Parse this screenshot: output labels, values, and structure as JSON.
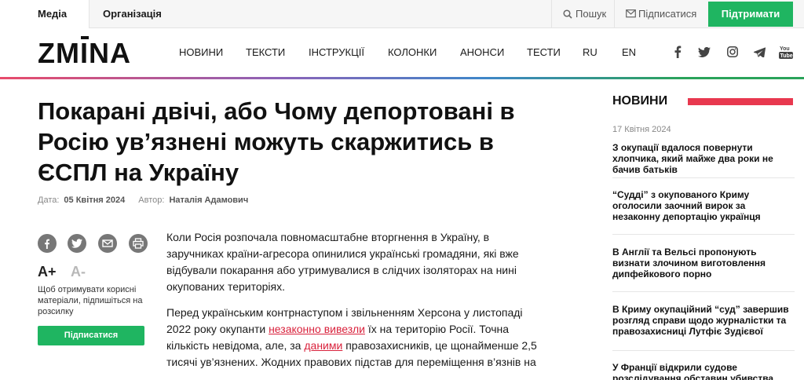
{
  "topbar": {
    "tab_media": "Медіа",
    "tab_org": "Організація",
    "search": "Пошук",
    "subscribe": "Підписатися",
    "support": "Підтримати"
  },
  "header": {
    "logo": "ZMINA",
    "nav": [
      "НОВИНИ",
      "ТЕКСТИ",
      "ІНСТРУКЦІЇ",
      "КОЛОНКИ",
      "АНОНСИ",
      "ТЕСТИ",
      "RU",
      "EN"
    ],
    "social": [
      "facebook-icon",
      "twitter-icon",
      "instagram-icon",
      "telegram-icon",
      "youtube-icon"
    ]
  },
  "article": {
    "title": "Покарані двічі, або Чому депортовані в Росію ув’язнені можуть скаржитись в ЄСПЛ на Україну",
    "date_label": "Дата:",
    "date": "05 Квітня 2024",
    "author_label": "Автор:",
    "author": "Наталія Адамович",
    "p1": "Коли Росія розпочала повномасштабне вторгнення в Україну, в заручниках країни-агресора опинилися українські громадяни, які вже відбували покарання або утримувалися в слідчих ізоляторах на нині окупованих територіях.",
    "p2_a": "Перед українським контрнаступом і звільненням Херсона у листопаді 2022 року окупанти ",
    "p2_link1": "незаконно вивезли",
    "p2_b": " їх на територію Росії. Точна кількість невідома, але, за ",
    "p2_link2": "даними",
    "p2_c": " правозахисників, це щонайменше 2,5 тисячі ув’язнених. Жодних правових підстав для переміщення в’язнів на"
  },
  "share": {
    "icons": [
      "facebook-icon",
      "twitter-icon",
      "mail-icon",
      "print-icon"
    ],
    "font_plus": "A+",
    "font_minus": "A-",
    "subscribe_text": "Щоб отримувати корисні матеріали, підпишіться на розсилку",
    "subscribe_button": "Підписатися"
  },
  "sidebar": {
    "title": "НОВИНИ",
    "date": "17 Квітня 2024",
    "items": [
      "З окупації вдалося повернути хлопчика, який майже два роки не бачив батьків",
      "“Судді” з окупованого Криму оголосили заочний вирок за незаконну депортацію українця",
      "В Англії та Вельсі пропонують визнати злочином виготовлення дипфейкового порно",
      "В Криму окупаційний “суд” завершив розгляд справи щодо журналістки та правозахисниці Лутфіє Зудієвої",
      "У Франції відкрили судове розслідування обставин убивства"
    ]
  },
  "colors": {
    "accent_green": "#1fb561",
    "accent_red": "#e8384f",
    "link_red": "#d9223c"
  }
}
